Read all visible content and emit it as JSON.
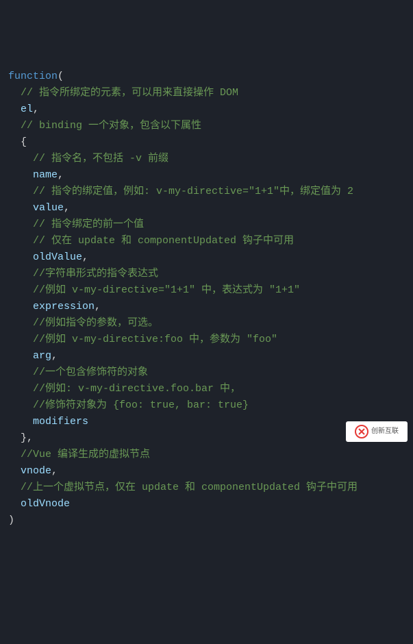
{
  "code": {
    "fn_kw": "function",
    "open_paren": "(",
    "c_el": "// 指令所绑定的元素，可以用来直接操作 DOM",
    "p_el": "el",
    "c_binding": "// binding 一个对象，包含以下属性",
    "brace_open": "{",
    "c_name": "// 指令名，不包括 -v 前缀",
    "p_name": "name",
    "c_value1": "// 指令的绑定值，例如: v-my-directive=\"1+1\"中，绑定值为 2",
    "p_value": "value",
    "c_oldv1": "// 指令绑定的前一个值",
    "c_oldv2": "// 仅在 update 和 componentUpdated 钩子中可用",
    "p_oldv": "oldValue",
    "c_expr1": "//字符串形式的指令表达式",
    "c_expr2": "//例如 v-my-directive=\"1+1\" 中，表达式为 \"1+1\"",
    "p_expr": "expression",
    "c_arg1": "//例如指令的参数，可选。",
    "c_arg2": "//例如 v-my-directive:foo 中，参数为 \"foo\"",
    "p_arg": "arg",
    "c_mod1": "//一个包含修饰符的对象",
    "c_mod2": "//例如: v-my-directive.foo.bar 中，",
    "c_mod3": "//修饰符对象为 {foo: true, bar: true}",
    "p_mod": "modifiers",
    "brace_close": "}",
    "c_vnode": "//Vue 编译生成的虚拟节点",
    "p_vnode": "vnode",
    "c_oldvn": "//上一个虚拟节点，仅在 update 和 componentUpdated 钩子中可用",
    "p_oldvn": "oldVnode",
    "close_paren": ")",
    "comma": ","
  },
  "watermark": "创新互联"
}
